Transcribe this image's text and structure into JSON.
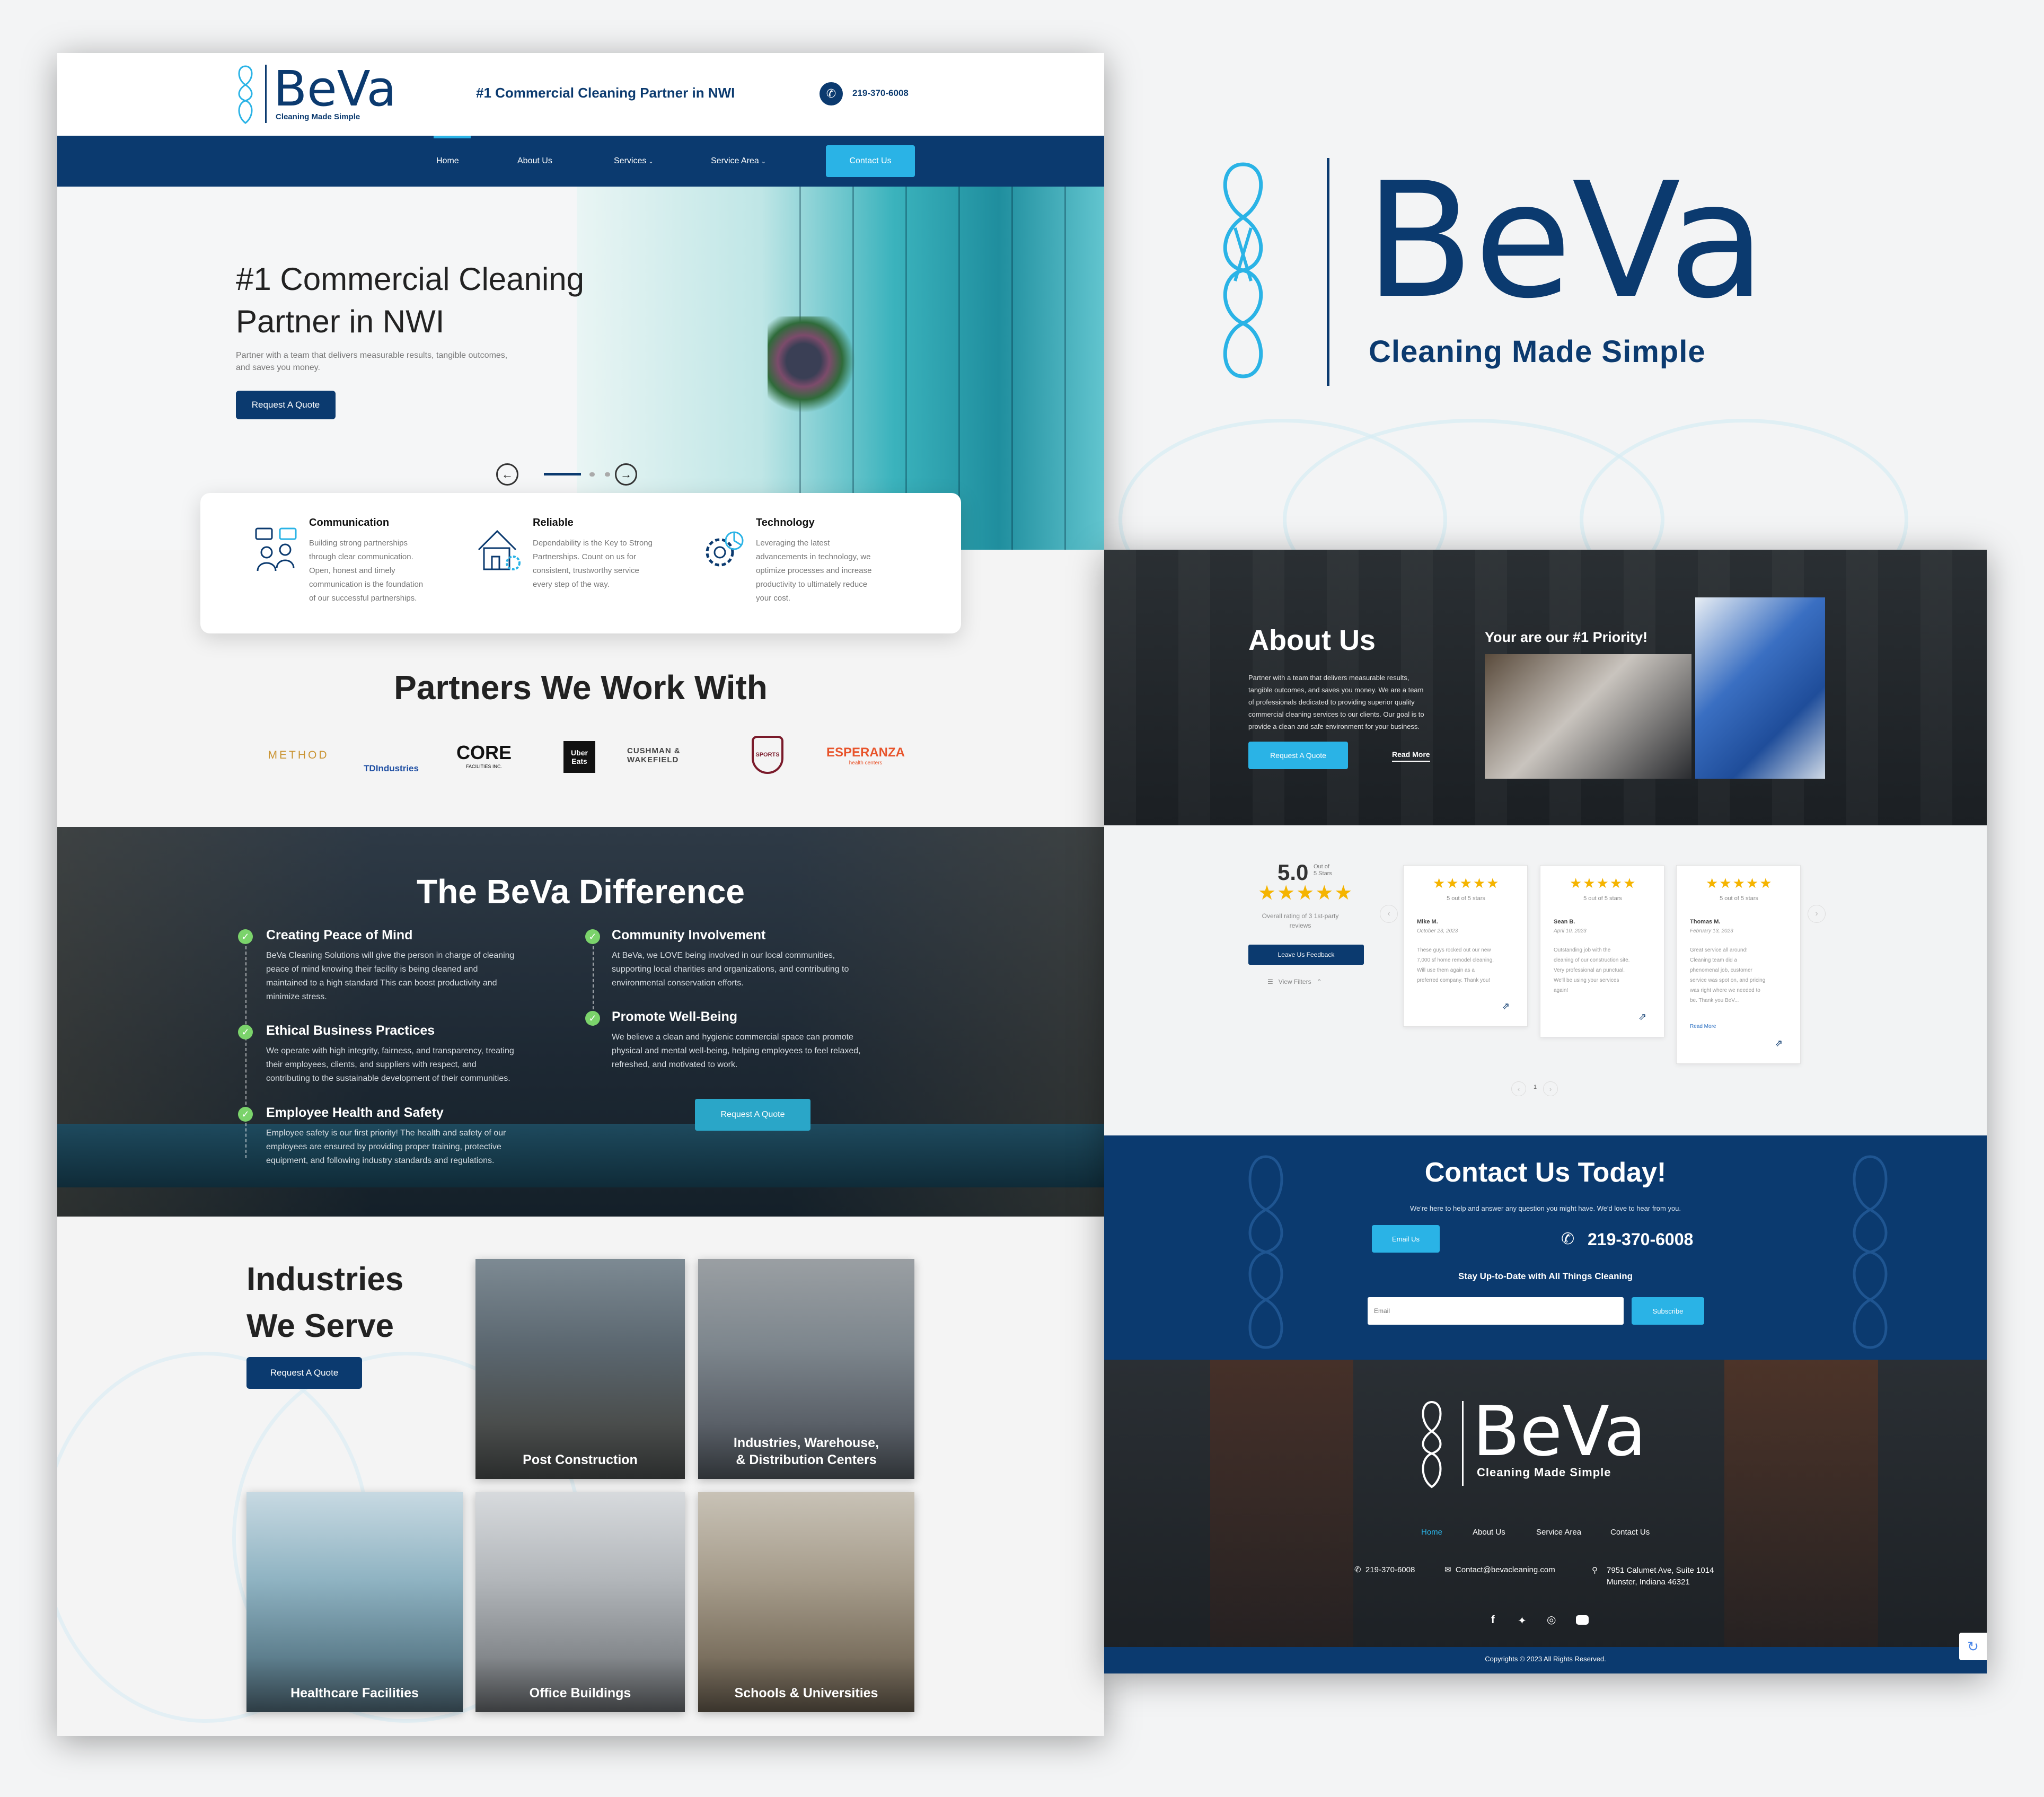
{
  "brand": {
    "name": "BeVa",
    "tagline": "Cleaning Made Simple"
  },
  "colors": {
    "navy": "#0b3a6f",
    "cyan": "#2ab3e6",
    "check_green": "#7bd36b",
    "star": "#f5b400"
  },
  "header": {
    "headline": "#1 Commercial Cleaning Partner in NWI",
    "phone": "219-370-6008"
  },
  "nav": {
    "items": [
      "Home",
      "About Us",
      "Services",
      "Service Area"
    ],
    "contact_button": "Contact Us"
  },
  "hero": {
    "title_line1": "#1 Commercial Cleaning",
    "title_line2": "Partner in NWI",
    "subtitle_line1": "Partner with a team that delivers measurable results, tangible outcomes,",
    "subtitle_line2": "and saves you money.",
    "cta": "Request A Quote"
  },
  "features": [
    {
      "title": "Communication",
      "icon": "communication-icon",
      "lines": [
        "Building strong partnerships",
        "through clear communication.",
        "Open, honest and timely",
        "communication is the foundation",
        "of our successful partnerships."
      ]
    },
    {
      "title": "Reliable",
      "icon": "house-gear-icon",
      "lines": [
        "Dependability is the Key to Strong",
        "Partnerships. Count on us for",
        "consistent, trustworthy service",
        "every step of the way."
      ]
    },
    {
      "title": "Technology",
      "icon": "technology-gear-icon",
      "lines": [
        "Leveraging the latest",
        "advancements in technology, we",
        "optimize processes and increase",
        "productivity to ultimately reduce",
        "your cost."
      ]
    }
  ],
  "partners": {
    "title": "Partners We Work With",
    "logos": [
      "METHOD",
      "TDIndustries",
      "CORE",
      "Uber Eats",
      "CUSHMAN & WAKEFIELD",
      "SPORTS",
      "ESPERANZA"
    ],
    "core_sub": "FACILITIES INC.",
    "esperanza_sub": "health centers"
  },
  "difference": {
    "title": "The BeVa Difference",
    "left": [
      {
        "title": "Creating Peace of Mind",
        "lines": [
          "BeVa Cleaning Solutions will give the person in charge of cleaning",
          "peace of mind knowing their facility is being cleaned and",
          "maintained to a high standard This can boost productivity and",
          "minimize stress."
        ]
      },
      {
        "title": "Ethical Business Practices",
        "lines": [
          "We operate with high integrity, fairness, and transparency, treating",
          "their employees, clients, and suppliers with respect, and",
          "contributing to the sustainable development of their communities."
        ]
      },
      {
        "title": "Employee Health and Safety",
        "lines": [
          "Employee safety is our first priority! The health and safety of our",
          "employees are ensured by providing proper training, protective",
          "equipment, and following industry standards and regulations."
        ]
      }
    ],
    "right": [
      {
        "title": "Community Involvement",
        "lines": [
          "At BeVa, we LOVE being involved in our local communities,",
          "supporting local charities and organizations, and contributing to",
          "environmental conservation efforts."
        ]
      },
      {
        "title": "Promote Well-Being",
        "lines": [
          "We believe a clean and hygienic commercial space can promote",
          "physical and mental well-being, helping employees to feel relaxed,",
          "refreshed, and motivated to work."
        ]
      }
    ],
    "cta": "Request A Quote"
  },
  "industries": {
    "title_line1": "Industries",
    "title_line2": "We Serve",
    "cta": "Request A Quote",
    "tiles": [
      {
        "line1": "Post Construction",
        "line2": ""
      },
      {
        "line1": "Industries, Warehouse,",
        "line2": "& Distribution Centers"
      },
      {
        "line1": "Healthcare Facilities",
        "line2": ""
      },
      {
        "line1": "Office Buildings",
        "line2": ""
      },
      {
        "line1": "Schools & Universities",
        "line2": ""
      }
    ]
  },
  "about": {
    "title": "About Us",
    "lines": [
      "Partner with a team that delivers measurable results,",
      "tangible outcomes, and saves you money. We are a team",
      "of professionals dedicated to providing superior quality",
      "commercial cleaning services to our clients. Our goal is to",
      "provide a clean and safe environment for your business."
    ],
    "cta": "Request A Quote",
    "read_more": "Read More",
    "priority": "Your are our #1 Priority!"
  },
  "reviews": {
    "score": "5.0",
    "out_of_line1": "Out of",
    "out_of_line2": "5 Stars",
    "stars": "★★★★★",
    "overall_line1": "Overall rating of 3 1st-party",
    "overall_line2": "reviews",
    "feedback_button": "Leave Us Feedback",
    "view_filters": "View Filters",
    "page": "1",
    "items": [
      {
        "rating_text": "5 out of 5 stars",
        "name": "Mike M.",
        "date": "October 23, 2023",
        "lines": [
          "These guys rocked out our new",
          "7,000 sf home remodel cleaning.",
          "Will use them again as a",
          "preferred company. Thank you!"
        ],
        "read_more": ""
      },
      {
        "rating_text": "5 out of 5 stars",
        "name": "Sean B.",
        "date": "April 10, 2023",
        "lines": [
          "Outstanding job with the",
          "cleaning of our construction site.",
          "Very professional an punctual.",
          "We'll be using your services",
          "again!"
        ],
        "read_more": ""
      },
      {
        "rating_text": "5 out of 5 stars",
        "name": "Thomas M.",
        "date": "February 13, 2023",
        "lines": [
          "Great service all around!",
          "Cleaning team did a",
          "phenomenal job, customer",
          "service was spot on, and pricing",
          "was right where we needed to",
          "be. Thank you BeV..."
        ],
        "read_more": "Read More"
      }
    ]
  },
  "contact": {
    "title": "Contact Us Today!",
    "subtitle": "We're here to help and answer any question you might have. We'd love to hear from you.",
    "email_button": "Email Us",
    "phone": "219-370-6008",
    "newsletter": "Stay Up-to-Date with All Things Cleaning",
    "email_placeholder": "Email",
    "subscribe": "Subscribe"
  },
  "footer": {
    "nav": [
      "Home",
      "About Us",
      "Service Area",
      "Contact Us"
    ],
    "phone": "219-370-6008",
    "email": "Contact@bevacleaning.com",
    "address_line1": "7951 Calumet Ave, Suite 1014",
    "address_line2": "Munster, Indiana 46321",
    "copyright": "Copyrights © 2023 All Rights Reserved."
  }
}
